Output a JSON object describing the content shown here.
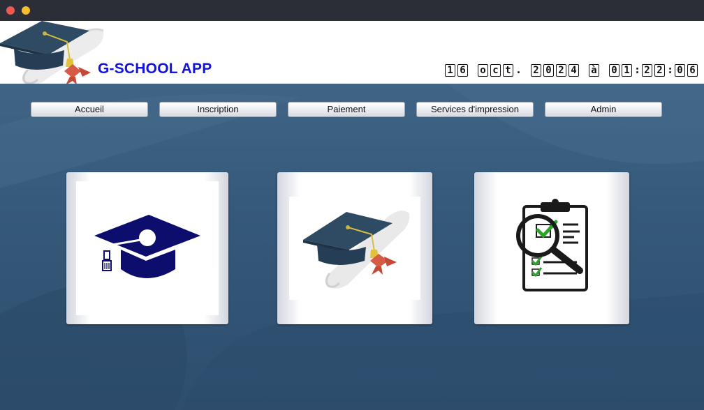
{
  "window": {
    "controls": [
      "close",
      "minimize"
    ]
  },
  "header": {
    "logo_icon": "graduation-cap-diploma-icon",
    "app_title": "G-SCHOOL APP",
    "datetime_chars": [
      "1",
      "6",
      " ",
      "o",
      "c",
      "t",
      ".",
      " ",
      "2",
      "0",
      "2",
      "4",
      " ",
      "à",
      " ",
      "0",
      "1",
      ":",
      "2",
      "2",
      ":",
      "0",
      "6"
    ]
  },
  "nav": {
    "accueil": "Accueil",
    "inscription": "Inscription",
    "paiement": "Paiement",
    "impression": "Services d'impression",
    "admin": "Admin"
  },
  "cards": [
    {
      "icon": "graduation-cap-icon"
    },
    {
      "icon": "graduation-cap-diploma-icon"
    },
    {
      "icon": "clipboard-checklist-magnifier-icon"
    }
  ],
  "colors": {
    "title": "#1313e0",
    "background": "#35597a",
    "cap_navy": "#0d0d6e",
    "cap_slate": "#2f4a63",
    "check_green": "#2aa52a"
  }
}
